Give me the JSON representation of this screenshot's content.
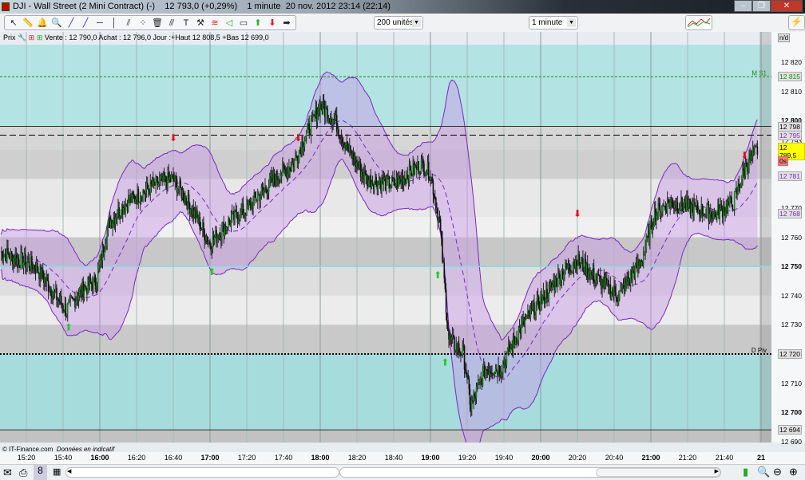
{
  "window": {
    "title": "DJI - Wall Street (2 Mini Contract) (-)",
    "quote": "12 793,0 (+0,29%)",
    "period": "1 minute",
    "datetime": "20 nov. 2012 23:14 (22:14)",
    "minimize": "–",
    "restore": "❐",
    "close": "✕"
  },
  "toolbar": {
    "tools": [
      "cursor-icon",
      "ruler-icon",
      "alarm-icon",
      "magnifier-icon",
      "line-icon",
      "trendline-icon",
      "horizontal-line-icon",
      "vertical-line-icon",
      "channel-icon",
      "points-icon",
      "trash-icon",
      "parallel-icon",
      "text-icon",
      "tools-icon",
      "fibonacci-icon",
      "fan-icon",
      "rectangle-icon",
      "buy-arrow-icon",
      "sell-arrow-icon",
      "right-arrow-icon"
    ],
    "units": "200 unités",
    "interval": "1 minute"
  },
  "infobar": {
    "label": "Prix",
    "text": "Vente : 12 790,0 Achat : 12 796,0 Jour :+Haut 12 808,5 +Bas 12 699,0"
  },
  "axis_corner": "n/d",
  "credit": {
    "source": "© IT-Finance.com",
    "note": "Données en indicatif"
  },
  "levels": [
    {
      "name": "M S1",
      "price": 12815,
      "label": "12 815",
      "color": "#1a8a1a"
    },
    {
      "name": "",
      "price": 12798,
      "label": "12 798",
      "color": "#000000"
    },
    {
      "name": "",
      "price": 12795,
      "label": "12 795",
      "color": "#7a2ac0"
    },
    {
      "name": "",
      "price": 12781,
      "label": "12 781",
      "color": "#7a2ac0"
    },
    {
      "name": "",
      "price": 12768,
      "label": "12 768",
      "color": "#7a2ac0"
    },
    {
      "name": "D Piv",
      "price": 12720,
      "label": "12 720",
      "color": "#000000"
    },
    {
      "name": "",
      "price": 12694,
      "label": "12 694",
      "color": "#000000"
    }
  ],
  "last_price": {
    "label": "12 789,5",
    "badge": "0s"
  },
  "chart_data": {
    "type": "candlestick",
    "price_ticks": [
      {
        "v": 12820,
        "t": "12 820"
      },
      {
        "v": 12810,
        "t": "12 810"
      },
      {
        "v": 12800,
        "t": "12 800",
        "bold": true
      },
      {
        "v": 12793,
        "t": "12 793"
      },
      {
        "v": 12790,
        "t": "12 790"
      },
      {
        "v": 12780,
        "t": "12 780"
      },
      {
        "v": 12770,
        "t": "12 770"
      },
      {
        "v": 12760,
        "t": "12 760"
      },
      {
        "v": 12750,
        "t": "12 750",
        "bold": true
      },
      {
        "v": 12740,
        "t": "12 740"
      },
      {
        "v": 12730,
        "t": "12 730"
      },
      {
        "v": 12710,
        "t": "12 710"
      },
      {
        "v": 12700,
        "t": "12 700",
        "bold": true
      },
      {
        "v": 12690,
        "t": "12 690"
      }
    ],
    "time_ticks": [
      {
        "m": 920,
        "t": "15:20"
      },
      {
        "m": 940,
        "t": "15:40"
      },
      {
        "m": 960,
        "t": "16:00",
        "bold": true
      },
      {
        "m": 980,
        "t": "16:20"
      },
      {
        "m": 1000,
        "t": "16:40"
      },
      {
        "m": 1020,
        "t": "17:00",
        "bold": true
      },
      {
        "m": 1040,
        "t": "17:20"
      },
      {
        "m": 1060,
        "t": "17:40"
      },
      {
        "m": 1080,
        "t": "18:00",
        "bold": true
      },
      {
        "m": 1100,
        "t": "18:20"
      },
      {
        "m": 1120,
        "t": "18:40"
      },
      {
        "m": 1140,
        "t": "19:00",
        "bold": true
      },
      {
        "m": 1160,
        "t": "19:20"
      },
      {
        "m": 1180,
        "t": "19:40"
      },
      {
        "m": 1200,
        "t": "20:00",
        "bold": true
      },
      {
        "m": 1220,
        "t": "20:20"
      },
      {
        "m": 1240,
        "t": "20:40"
      },
      {
        "m": 1260,
        "t": "21:00",
        "bold": true
      },
      {
        "m": 1280,
        "t": "21:20"
      },
      {
        "m": 1300,
        "t": "21:40"
      },
      {
        "m": 1320,
        "t": "21",
        "bold": true
      }
    ],
    "price_path": [
      [
        906,
        12755
      ],
      [
        925,
        12750
      ],
      [
        936,
        12740
      ],
      [
        942,
        12735
      ],
      [
        950,
        12742
      ],
      [
        958,
        12745
      ],
      [
        965,
        12765
      ],
      [
        975,
        12772
      ],
      [
        990,
        12778
      ],
      [
        1000,
        12780
      ],
      [
        1008,
        12772
      ],
      [
        1020,
        12758
      ],
      [
        1030,
        12765
      ],
      [
        1040,
        12770
      ],
      [
        1055,
        12780
      ],
      [
        1065,
        12785
      ],
      [
        1072,
        12795
      ],
      [
        1080,
        12805
      ],
      [
        1088,
        12800
      ],
      [
        1095,
        12790
      ],
      [
        1105,
        12780
      ],
      [
        1120,
        12778
      ],
      [
        1135,
        12785
      ],
      [
        1140,
        12782
      ],
      [
        1145,
        12765
      ],
      [
        1150,
        12725
      ],
      [
        1158,
        12720
      ],
      [
        1162,
        12702
      ],
      [
        1170,
        12715
      ],
      [
        1178,
        12715
      ],
      [
        1190,
        12730
      ],
      [
        1200,
        12738
      ],
      [
        1212,
        12748
      ],
      [
        1220,
        12752
      ],
      [
        1232,
        12745
      ],
      [
        1242,
        12740
      ],
      [
        1255,
        12752
      ],
      [
        1262,
        12768
      ],
      [
        1270,
        12772
      ],
      [
        1282,
        12770
      ],
      [
        1295,
        12768
      ],
      [
        1305,
        12772
      ],
      [
        1312,
        12785
      ],
      [
        1318,
        12790
      ]
    ],
    "buy_signals": [
      [
        943,
        12728
      ],
      [
        1021,
        12747
      ],
      [
        1144,
        12746
      ],
      [
        1148,
        12716
      ]
    ],
    "sell_signals": [
      [
        1000,
        12793
      ],
      [
        1068,
        12793
      ],
      [
        1220,
        12767
      ],
      [
        1311,
        12787
      ]
    ]
  }
}
